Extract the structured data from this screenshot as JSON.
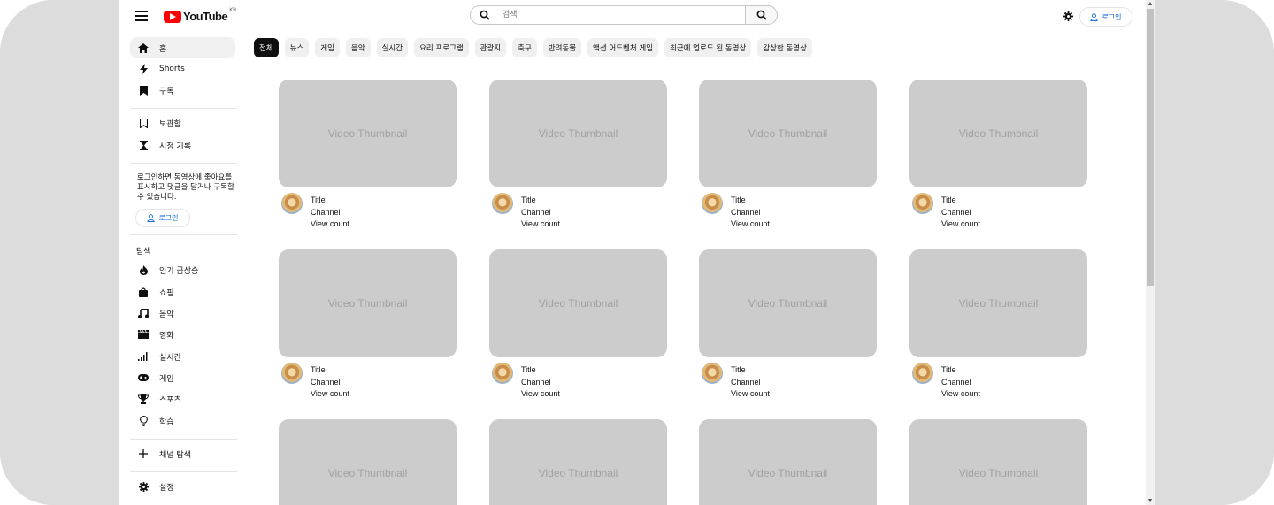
{
  "header": {
    "logo_text": "YouTube",
    "logo_region": "KR",
    "search_placeholder": "검색",
    "login_label": "로그인"
  },
  "sidebar": {
    "main": [
      {
        "label": "홈",
        "icon": "home-icon"
      },
      {
        "label": "Shorts",
        "icon": "shorts-icon"
      },
      {
        "label": "구독",
        "icon": "subscriptions-icon"
      }
    ],
    "library": [
      {
        "label": "보관함",
        "icon": "library-icon"
      },
      {
        "label": "시청 기록",
        "icon": "history-icon"
      }
    ],
    "login_prompt": "로그인하면 동영상에 좋아요를 표시하고 댓글을 달거나 구독할 수 있습니다.",
    "login_label": "로그인",
    "explore_heading": "탐색",
    "explore": [
      {
        "label": "인기 급상승",
        "icon": "trending-icon"
      },
      {
        "label": "쇼핑",
        "icon": "shopping-bag-icon"
      },
      {
        "label": "음악",
        "icon": "music-icon"
      },
      {
        "label": "영화",
        "icon": "movie-icon"
      },
      {
        "label": "실시간",
        "icon": "live-icon"
      },
      {
        "label": "게임",
        "icon": "gaming-icon"
      },
      {
        "label": "스포츠",
        "icon": "trophy-icon"
      },
      {
        "label": "학습",
        "icon": "lightbulb-icon"
      }
    ],
    "browse_channels": "채널 탐색",
    "settings": "설정"
  },
  "chips": [
    "전체",
    "뉴스",
    "게임",
    "음악",
    "실시간",
    "요리 프로그램",
    "관광지",
    "축구",
    "반려동물",
    "액션 어드벤처 게임",
    "최근에 업로드 된 동영상",
    "감상한 동영상"
  ],
  "videos": {
    "thumbnail_text": "Video Thumbnail",
    "title": "Title",
    "channel": "Channel",
    "views": "View count"
  },
  "colors": {
    "accent_red": "#ff0000",
    "link_blue": "#065fd4",
    "chip_bg": "#f0f0f0",
    "thumb_bg": "#cccccc"
  }
}
